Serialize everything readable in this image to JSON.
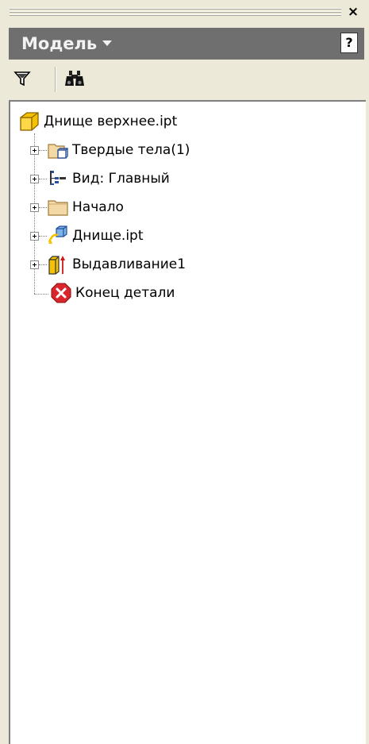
{
  "window": {
    "close_glyph": "×"
  },
  "header": {
    "title": "Модель",
    "help_glyph": "?"
  },
  "toolbar": {
    "filter_icon": "filter-icon",
    "find_icon": "binoculars-icon"
  },
  "tree": {
    "root": {
      "label": "Днище верхнее.ipt",
      "icon": "part-icon"
    },
    "items": [
      {
        "label": "Твердые тела(1)",
        "icon": "solid-bodies-folder-icon",
        "expandable": true
      },
      {
        "label": "Вид: Главный",
        "icon": "view-representation-icon",
        "expandable": true
      },
      {
        "label": "Начало",
        "icon": "origin-folder-icon",
        "expandable": true
      },
      {
        "label": "Днище.ipt",
        "icon": "derived-part-icon",
        "expandable": true
      },
      {
        "label": "Выдавливание1",
        "icon": "extrusion-icon",
        "expandable": true
      },
      {
        "label": "Конец детали",
        "icon": "end-of-part-icon",
        "expandable": false
      }
    ]
  },
  "colors": {
    "header_bg": "#6f6f6f",
    "window_bg": "#ece9d8",
    "part_yellow": "#f5c200",
    "end_red": "#d9262c"
  }
}
